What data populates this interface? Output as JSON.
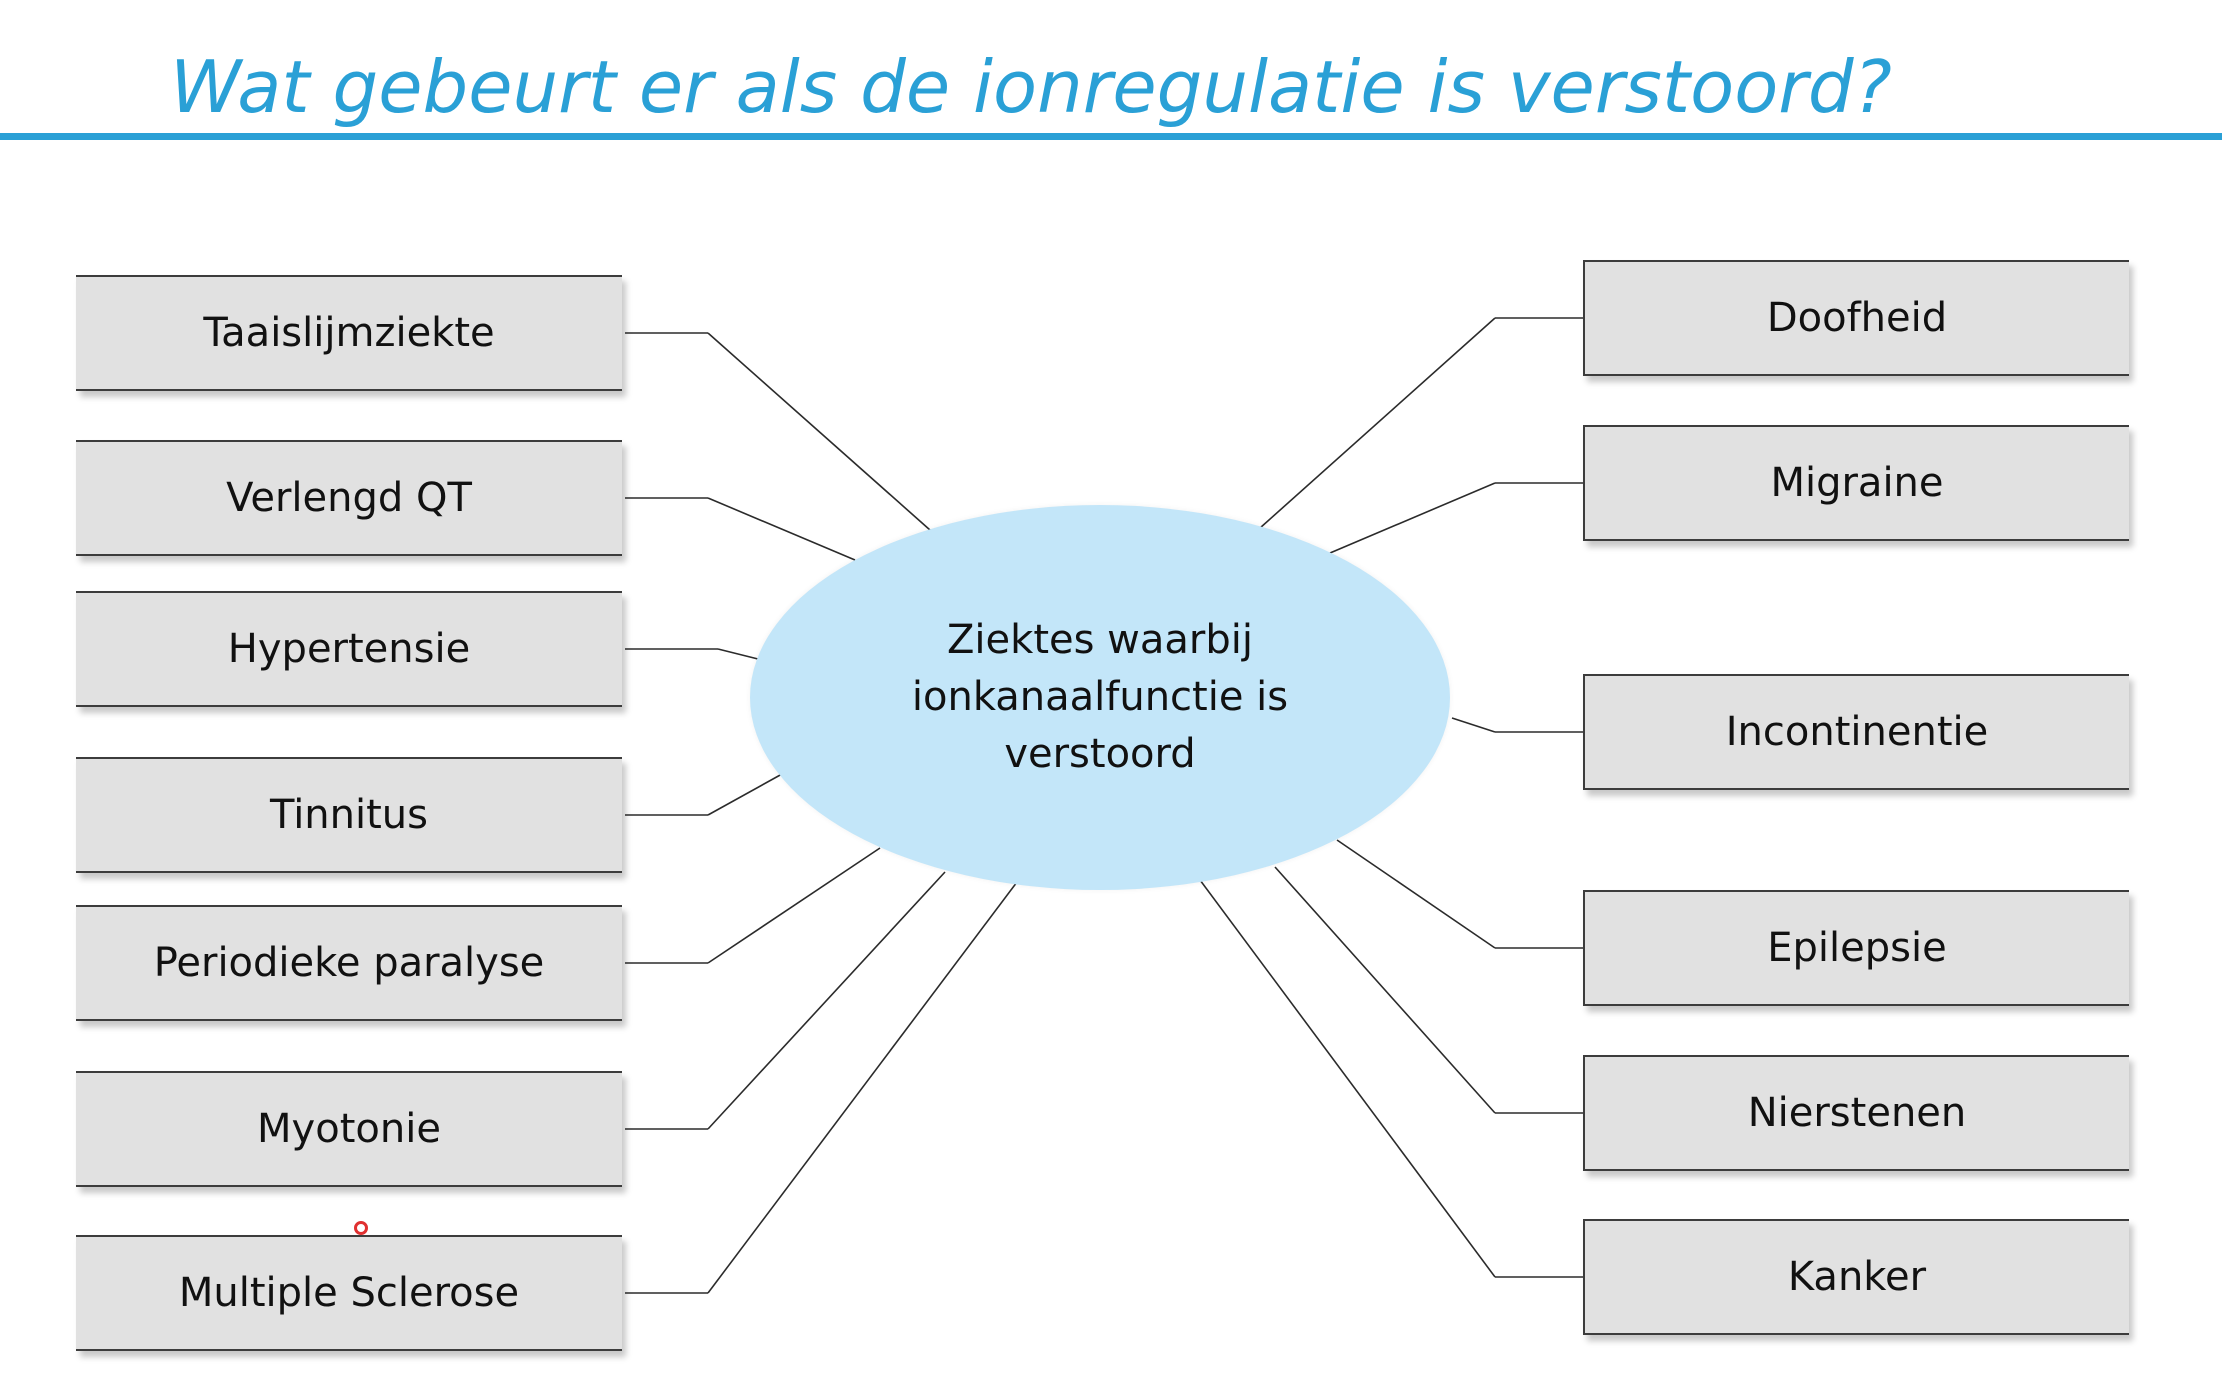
{
  "title": "Wat gebeurt er als de ionregulatie is verstoord?",
  "center": {
    "lines": [
      "Ziektes waarbij",
      "ionkanaalfunctie is",
      "verstoord"
    ]
  },
  "left_items": [
    {
      "label": "Taaislijmziekte"
    },
    {
      "label": "Verlengd QT"
    },
    {
      "label": "Hypertensie"
    },
    {
      "label": "Tinnitus"
    },
    {
      "label": "Periodieke paralyse"
    },
    {
      "label": "Myotonie"
    },
    {
      "label": "Multiple Sclerose"
    }
  ],
  "right_items": [
    {
      "label": "Doofheid"
    },
    {
      "label": "Migraine"
    },
    {
      "label": "Incontinentie"
    },
    {
      "label": "Epilepsie"
    },
    {
      "label": "Nierstenen"
    },
    {
      "label": "Kanker"
    }
  ],
  "colors": {
    "title": "#2aa0d6",
    "ellipse_fill": "#c3e6f9",
    "box_fill": "#e1e1e1",
    "pointer": "#e03030"
  }
}
